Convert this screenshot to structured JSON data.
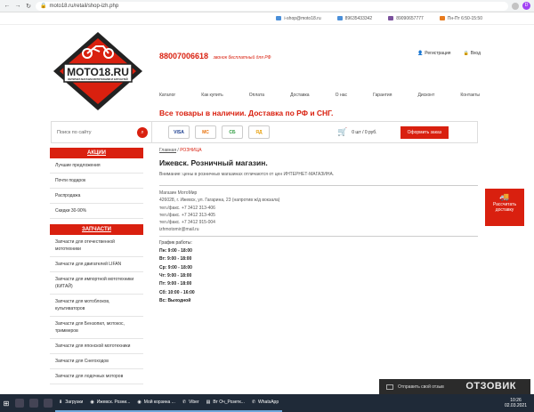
{
  "browser": {
    "url": "moto18.ru/retail/shop-izh.php",
    "profile_initial": "D"
  },
  "topbar": {
    "email": "i-shop@moto18.ru",
    "phone1": "89635433342",
    "phone2": "89090657777",
    "hours": "Пн-Пт 6:50-15:50"
  },
  "logo": {
    "text": "MOTO18.RU",
    "subtitle": "ИНТЕРНЕТ-МАГАЗИН МОТОТЕХНИКИ И ЗАПЧАСТЕЙ"
  },
  "header": {
    "phone": "88007006618",
    "phone_note": "звонок бесплатный для РФ",
    "register": "Регистрация",
    "login": "Вход",
    "slogan": "Все товары в наличии. Доставка по РФ и СНГ."
  },
  "menu": [
    "Каталог",
    "Как купить",
    "Оплата",
    "Доставка",
    "О нас",
    "Гарантия",
    "Дисконт",
    "Контакты"
  ],
  "search": {
    "placeholder": "Поиск по сайту"
  },
  "payments": [
    "VISA",
    "MC",
    "СБ",
    "ЯД"
  ],
  "cart": {
    "summary": "0 шт / 0 руб.",
    "order_button": "Оформить заказ"
  },
  "sidebar": {
    "promo_title": "АКЦИИ",
    "promo_items": [
      "Лучшие предложения",
      "Почти подарок",
      "Распродажа",
      "Скидки 30-90%"
    ],
    "parts_title": "ЗАПЧАСТИ",
    "parts_items": [
      "Запчасти для отечественной мототехники",
      "Запчасти для двигателей LIFAN",
      "Запчасти для импортной мототехники (КИТАЙ)",
      "Запчасти для мотоблоков, культиваторов",
      "Запчасти для Бензопил, мотокос, триммеров",
      "Запчасти для японской мототехники",
      "Запчасти для Снегоходов",
      "Запчасти для лодочных моторов"
    ]
  },
  "content": {
    "crumb_home": "Главная",
    "crumb_current": "РОЗНИЦА",
    "title": "Ижевск. Розничный магазин.",
    "note": "Внимание: цены в розничных магазинах отличаются от цен ИНТЕРНЕТ-МАГАЗИНА.",
    "info": [
      "Магазин МотоМир",
      "426028, г. Ижевск, ул. Гагарина, 23 (напротив ж/д вокзала)",
      "тел./факс. +7 3412 313-406",
      "тел./факс. +7 3412 313-405",
      "тел./факс. +7 3412 915-004",
      "izhmotomir@mail.ru"
    ],
    "schedule_title": "График работы:",
    "schedule": [
      "Пн: 9:00 - 18:00",
      "Вт: 9:00 - 18:00",
      "Ср: 9:00 - 18:00",
      "Чт: 9:00 - 18:00",
      "Пт: 9:00 - 18:00",
      "Сб: 10:00 - 16:00",
      "Вс: Выходной"
    ]
  },
  "delivery_button": "Рассчитать доставку",
  "taskbar": {
    "downloads": "Загрузки",
    "t1": "Ижевск. Розни...",
    "t2": "Мой корзина ...",
    "t3": "Viber",
    "t4": "Вт Оч_Розетк...",
    "t5": "WhatsApp",
    "time": "10:26",
    "date": "02.03.2021"
  },
  "notification": "Отправить свой отзыв",
  "watermark": "ОТЗОВИК"
}
